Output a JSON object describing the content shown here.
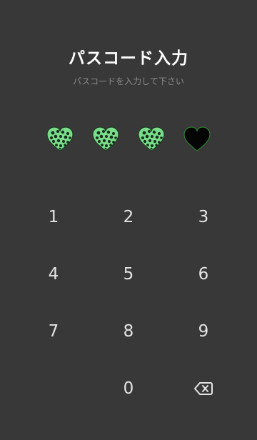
{
  "header": {
    "title": "パスコード入力",
    "subtitle": "パスコードを入力して下さい"
  },
  "indicators": {
    "filled_count": 3,
    "total": 4,
    "filled_icon": "green-leopard-heart-icon",
    "empty_icon": "black-heart-icon",
    "accent_color": "#7bdc8c",
    "empty_outline_color": "#2e7d32"
  },
  "keypad": {
    "keys": [
      "1",
      "2",
      "3",
      "4",
      "5",
      "6",
      "7",
      "8",
      "9",
      "0"
    ],
    "backspace_icon": "backspace-icon"
  },
  "colors": {
    "background": "#383838",
    "title": "#ffffff",
    "subtitle": "#8a8a8a",
    "key_text": "#e4e4e4"
  }
}
